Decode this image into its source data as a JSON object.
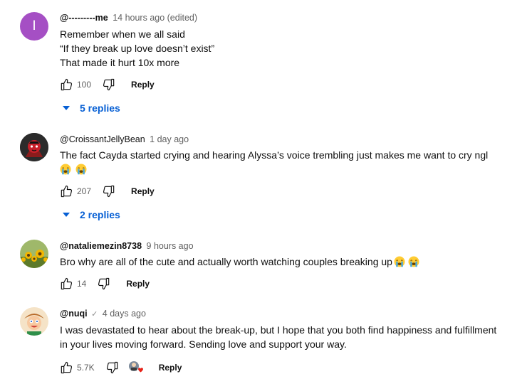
{
  "comments": [
    {
      "author": "@---------me",
      "time": "14 hours ago (edited)",
      "avatar_letter": "I",
      "lines": [
        "Remember when we all said",
        "“If they break up love doesn’t exist”",
        "That made it hurt 10x more"
      ],
      "likes": "100",
      "reply_label": "Reply",
      "replies_label": "5 replies"
    },
    {
      "author": "@CroissantJellyBean",
      "time": "1 day ago",
      "lines": [
        "The fact Cayda started crying and hearing Alyssa’s voice trembling just makes me want to cry ngl"
      ],
      "likes": "207",
      "reply_label": "Reply",
      "replies_label": "2 replies"
    },
    {
      "author": "@nataliemezin8738",
      "time": "9 hours ago",
      "lines": [
        "Bro why are all of the cute and actually worth watching couples breaking up"
      ],
      "likes": "14",
      "reply_label": "Reply"
    },
    {
      "author": "@nuqi",
      "time": "4 days ago",
      "lines": [
        "I was devastated to hear about the break-up, but I hope that you both find happiness and fulfillment",
        "in your lives moving forward. Sending love and support your way."
      ],
      "likes": "5.7K",
      "reply_label": "Reply"
    }
  ],
  "colors": {
    "link": "#065fd4",
    "meta": "#606060",
    "avatar1": "#a54fc4"
  }
}
